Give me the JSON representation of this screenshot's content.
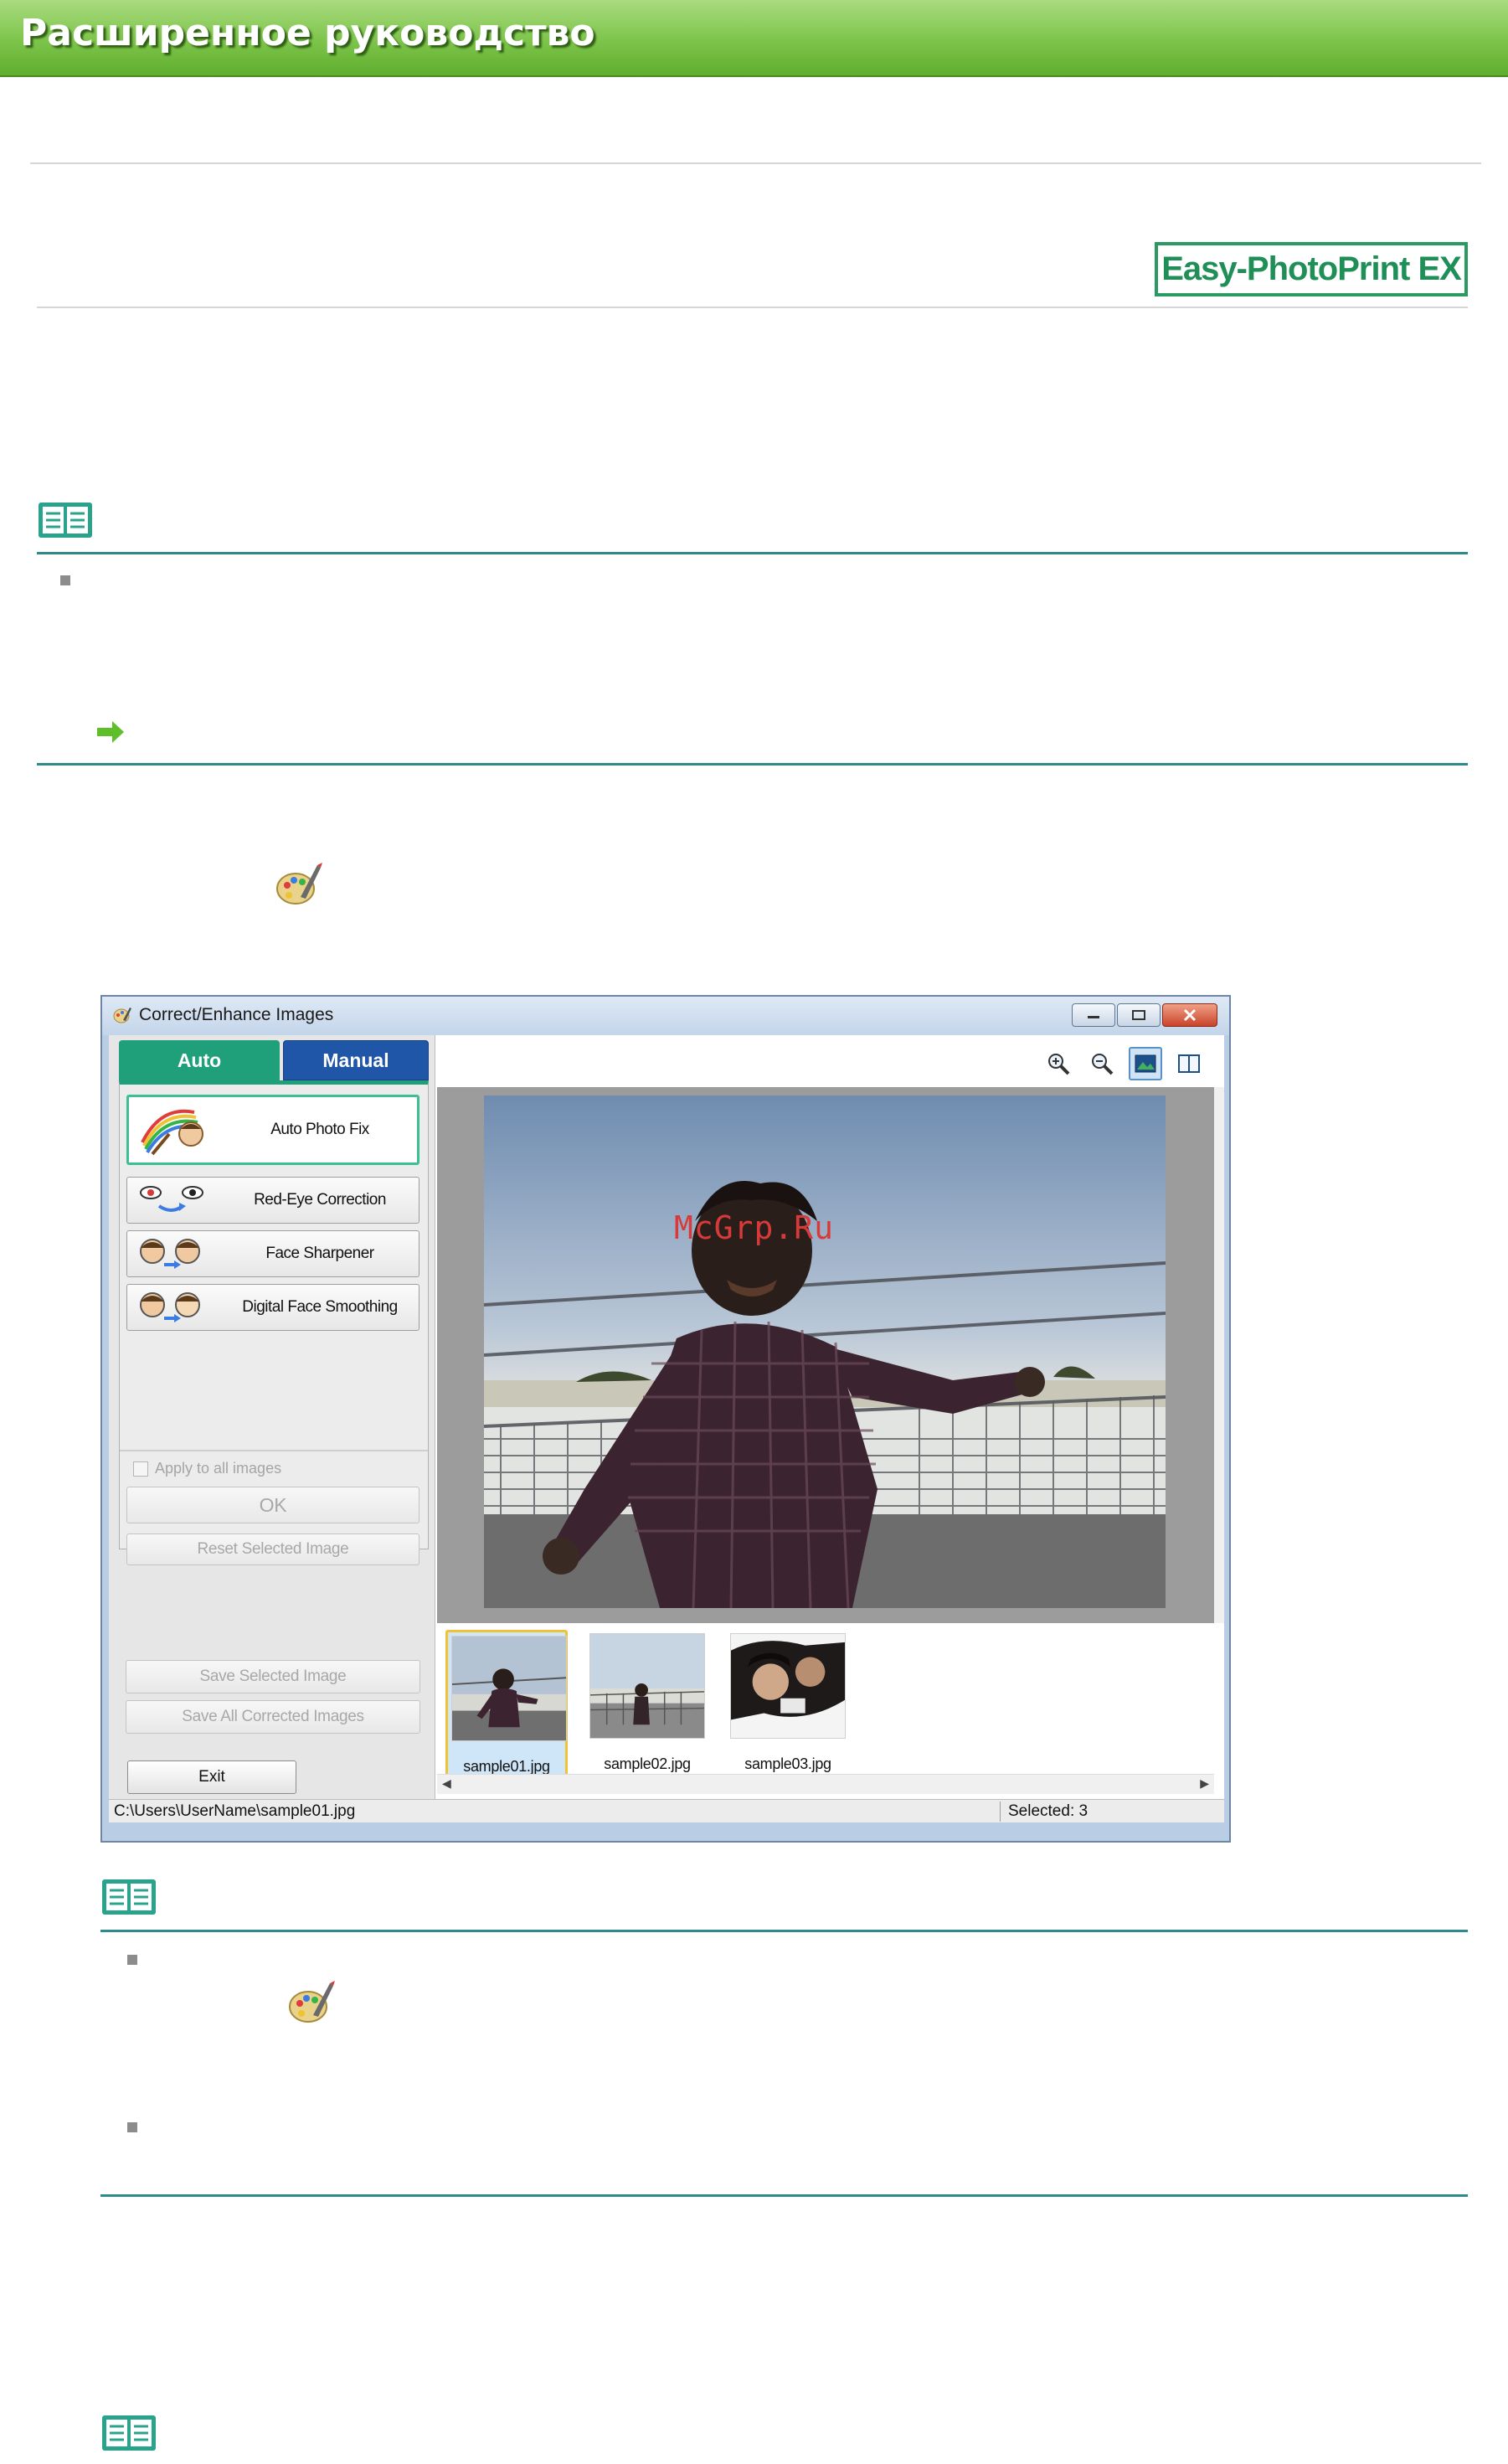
{
  "page": {
    "header_title": "Расширенное руководство",
    "product_badge": "Easy-PhotoPrint EX"
  },
  "window": {
    "title": "Correct/Enhance Images",
    "tabs": [
      {
        "label": "Auto"
      },
      {
        "label": "Manual"
      }
    ],
    "correction_buttons": [
      {
        "label": "Auto Photo Fix",
        "icon": "auto-photo-fix-icon"
      },
      {
        "label": "Red-Eye Correction",
        "icon": "red-eye-correction-icon"
      },
      {
        "label": "Face Sharpener",
        "icon": "face-sharpener-icon"
      },
      {
        "label": "Digital Face Smoothing",
        "icon": "digital-face-smoothing-icon"
      }
    ],
    "apply_all_label": "Apply to all images",
    "ok_label": "OK",
    "reset_label": "Reset Selected Image",
    "save_selected_label": "Save Selected Image",
    "save_all_label": "Save All Corrected Images",
    "exit_label": "Exit",
    "thumbnails": [
      {
        "label": "sample01.jpg"
      },
      {
        "label": "sample02.jpg"
      },
      {
        "label": "sample03.jpg"
      }
    ],
    "status_path": "C:\\Users\\UserName\\sample01.jpg",
    "status_selected": "Selected: 3",
    "accent_auto_tab": "#1fa07a",
    "accent_manual_tab": "#1f56a8"
  },
  "watermark": "McGrp.Ru",
  "colors": {
    "header_green": "#7dc44a",
    "badge_green": "#2a9a62",
    "rule_teal": "#2e8b8b"
  }
}
